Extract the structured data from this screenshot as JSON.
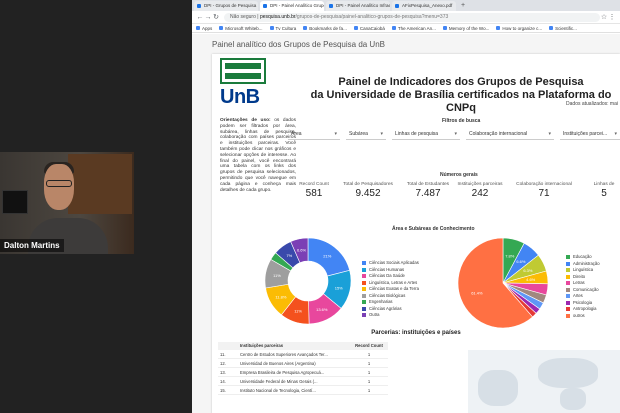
{
  "webcam": {
    "name": "Dalton Martins"
  },
  "browser": {
    "tabs": [
      {
        "label": "DPI - Grupos de Pesquisa",
        "active": false
      },
      {
        "label": "DPI - Painel Analítico Grupos ...",
        "active": true
      },
      {
        "label": "DPI - Painel Analítico Infraestr...",
        "active": false
      },
      {
        "label": "AFixPesquisa_Anexo.pdf",
        "active": false
      }
    ],
    "new_tab": "+",
    "security": "Não seguro",
    "url_host": "pesquisa.unb.br",
    "url_path": "/grupos-de-pesquisa/painel-analitico-grupos-de-pesquisa?menu=373",
    "bookmarks": [
      "Apps",
      "Microsoft Whiteb...",
      "Tv Cultura",
      "Bookmarks de fa...",
      "CanaCaiobá",
      "The American An...",
      "Memory of the Wo...",
      "How to organize c...",
      "Scientific..."
    ]
  },
  "page": {
    "title": "Painel analítico dos Grupos de Pesquisa da UnB",
    "logo_text": "UnB",
    "guide_heading": "Orientações de uso:",
    "guide_text": "os dados podem ser filtrados por área, subárea, linhas de pesquisa, colaboração com países parceiros e instituições parceiras. Você também pode clicar nos gráficos e selecionar opções de interesse. Ao final do painel, você encontrará uma tabela com os links dos grupos de pesquisa selecionados, permitindo que você navegue em cada página e conheça mais detalhes de cada grupo.",
    "header_line1": "Painel de Indicadores dos Grupos de Pesquisa",
    "header_line2": "da Universidade de Brasília certificados na Plataforma do CNPq",
    "updated": "Dados atualizados: mai",
    "filters_title": "Filtros de busca",
    "filters": [
      "Área",
      "Subárea",
      "Linhas de pesquisa",
      "Colaboração internacional",
      "Instituições parcei..."
    ],
    "metrics_title": "Números gerais",
    "metrics": [
      {
        "label": "Record Count",
        "value": "581"
      },
      {
        "label": "Total de Pesquisadores",
        "value": "9.452"
      },
      {
        "label": "Total de Estudantes",
        "value": "7.487"
      },
      {
        "label": "Instituições parceiras",
        "value": "242"
      },
      {
        "label": "Colaboração internacional",
        "value": "71"
      },
      {
        "label": "Linhas de",
        "value": "5"
      }
    ],
    "areas_title": "Área e Subáreas de Conhecimento",
    "donut_legend": [
      "Ciências Sociais Aplicadas",
      "Ciências Humanas",
      "Ciências Da Saúde",
      "Linguística, Letras e Artes",
      "Ciências Exatas e da Terra",
      "Ciências Biológicas",
      "Engenharias",
      "Ciências Agrárias",
      "Outra"
    ],
    "pie_legend": [
      "Educação",
      "Administração",
      "Linguística",
      "Direito",
      "Letras",
      "Comunicação",
      "Artes",
      "Psicologia",
      "Antropologia",
      "outros"
    ],
    "partners_title": "Parcerias: instituições e países",
    "table_headers": [
      "",
      "Instituições parceiras",
      "Record Count"
    ],
    "table_rows": [
      {
        "n": "11.",
        "name": "Centro de Estudos Superiores Avançados Ter...",
        "count": "1"
      },
      {
        "n": "12.",
        "name": "Universidad de Buenos Aires (Argentina)",
        "count": "1"
      },
      {
        "n": "13.",
        "name": "Empresa Brasileira de Pesquisa Agropecuá...",
        "count": "1"
      },
      {
        "n": "14.",
        "name": "Universidade Federal de Minas Gerais (...",
        "count": "1"
      },
      {
        "n": "15.",
        "name": "Instituto Nacional de Tecnologia, Cientí...",
        "count": "1"
      }
    ],
    "colors": {
      "donut": [
        "#4285f4",
        "#1aa0d8",
        "#e8479d",
        "#f4511e",
        "#fbbc04",
        "#9e9e9e",
        "#34a853",
        "#3949ab",
        "#7b3fb5"
      ],
      "pie": [
        "#34a853",
        "#4285f4",
        "#c0ca33",
        "#fbbc04",
        "#e8479d",
        "#a1887f",
        "#5e97f6",
        "#9c27b0",
        "#e53935",
        "#ff7043"
      ]
    }
  },
  "chart_data": [
    {
      "type": "pie",
      "categories": [
        "Ciências Sociais Aplicadas",
        "Ciências Humanas",
        "Ciências Da Saúde",
        "Linguística, Letras e Artes",
        "Ciências Exatas e da Terra",
        "Ciências Biológicas",
        "Engenharias",
        "Ciências Agrárias",
        "Outra"
      ],
      "values": [
        21,
        15,
        13.6,
        11,
        11.8,
        11,
        3,
        7,
        6.6
      ],
      "labels": [
        "21%",
        "15%",
        "13.6%",
        "11%",
        "11.8%",
        "11%",
        "",
        "7%",
        "6.6%"
      ],
      "donut": true
    },
    {
      "type": "pie",
      "categories": [
        "Educação",
        "Administração",
        "Linguística",
        "Direito",
        "Letras",
        "Comunicação",
        "Artes",
        "Psicologia",
        "Antropologia",
        "outros"
      ],
      "values": [
        7.8,
        6.6,
        6.3,
        4.6,
        4,
        3,
        2.5,
        2,
        1.8,
        61.4
      ],
      "labels": [
        "7.8%",
        "6.6%",
        "6.3%",
        "4.6%",
        "",
        "",
        "",
        "",
        "",
        "61.4%"
      ],
      "donut": false
    }
  ]
}
